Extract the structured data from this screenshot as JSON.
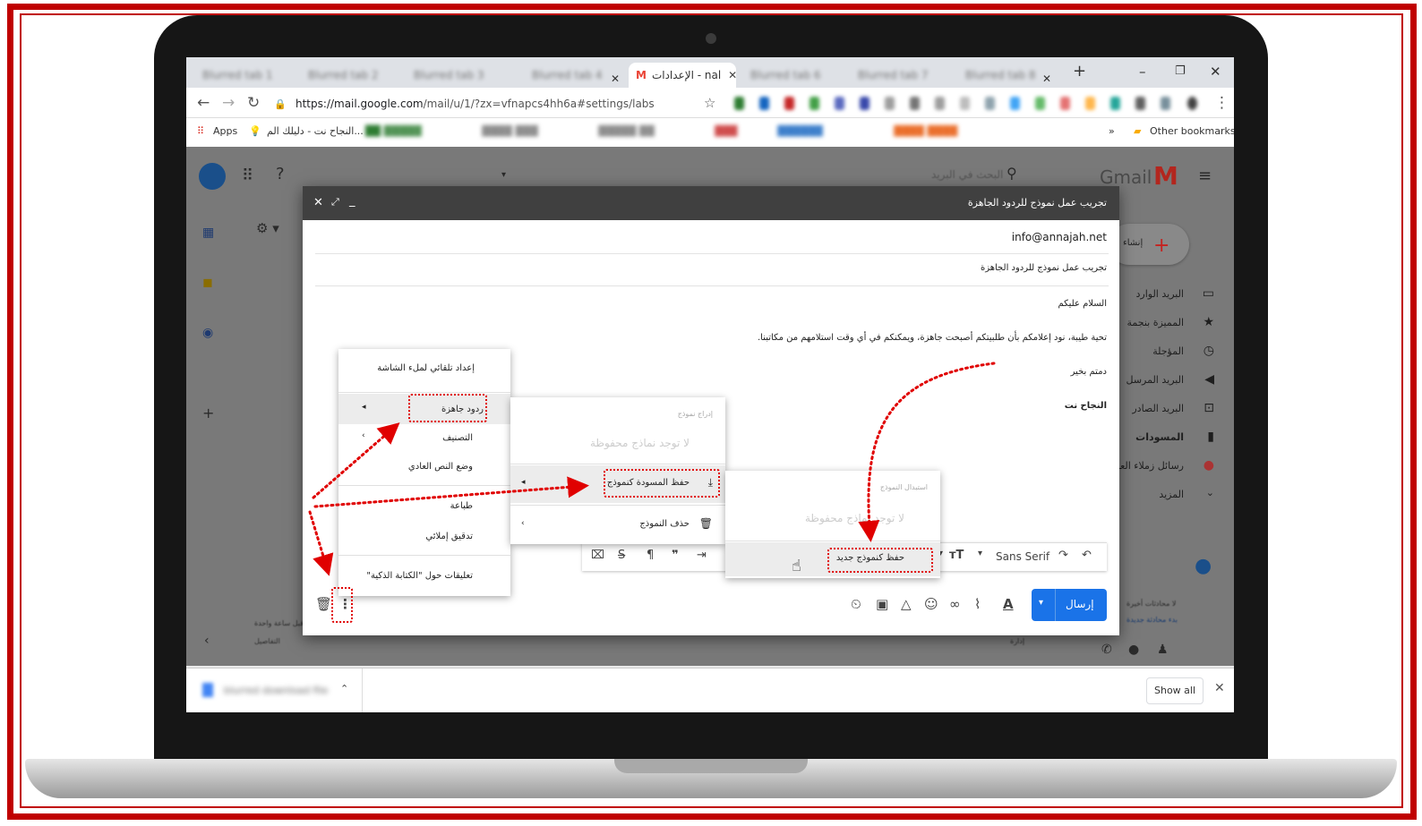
{
  "browser": {
    "tabs": [
      {
        "label": "Blurred tab 1",
        "blurred": true
      },
      {
        "label": "Blurred tab 2",
        "blurred": true
      },
      {
        "label": "Blurred tab 3",
        "blurred": true
      },
      {
        "label": "Blurred tab 4",
        "blurred": true
      },
      {
        "label": "الإعدادات - nal",
        "active": true
      },
      {
        "label": "Blurred tab 6",
        "blurred": true
      },
      {
        "label": "Blurred tab 7",
        "blurred": true
      },
      {
        "label": "Blurred tab 8",
        "blurred": true
      }
    ],
    "url_host": "https://mail.google.com",
    "url_path": "/mail/u/1/?zx=vfnapcs4hh6a#settings/labs",
    "bookmarks": {
      "apps": "Apps",
      "first": "النجاح نت - دليلك الم...",
      "more": "»",
      "other": "Other bookmarks"
    },
    "new_tab": "+"
  },
  "gmail": {
    "logo": "Gmail",
    "search_placeholder": "البحث في البريد",
    "compose": "إنشاء",
    "nav": [
      {
        "label": "البريد الوارد",
        "icon": "inbox-icon"
      },
      {
        "label": "المميزة بنجمة",
        "icon": "star-icon"
      },
      {
        "label": "المؤجلة",
        "icon": "clock-icon"
      },
      {
        "label": "البريد المرسل",
        "icon": "send-icon"
      },
      {
        "label": "البريد الصادر",
        "icon": "outbox-icon"
      },
      {
        "label": "المسودات",
        "icon": "draft-icon"
      },
      {
        "label": "رسائل زملاء العمل",
        "icon": "label-icon"
      },
      {
        "label": "المزيد",
        "icon": "chevron-down-icon"
      }
    ],
    "left_fragments": {
      "a": "آخر نشاط للحساب: قبل ساعة واحدة",
      "b": "التفاصيل",
      "c": "إدارة"
    },
    "right_fragments": {
      "a": "لا محادثات أخيرة",
      "b": "بدء محادثة جديدة"
    }
  },
  "compose": {
    "title": "تجريب عمل نموذج للردود الجاهزة",
    "to": "info@annajah.net",
    "subject": "تجريب عمل نموذج للردود الجاهزة",
    "body": [
      "السلام عليكم",
      "تحية طيبة، نود إعلامكم بأن طلبيتكم أصبحت جاهزة، ويمكنكم في أي وقت استلامهم من مكاتبنا.",
      "دمتم بخير",
      "النجاح نت"
    ],
    "font": "Sans Serif",
    "send": "إرسال"
  },
  "menu_more": [
    "إعداد تلقائي لملء الشاشة",
    "ردود جاهزة",
    "التصنيف",
    "وضع النص العادي",
    "طباعة",
    "تدقيق إملائي",
    "تعليقات حول \"الكتابة الذكية\""
  ],
  "menu_canned": {
    "insert_header": "إدراج نموذج",
    "no_templates": "لا توجد نماذج محفوظة",
    "save_draft": "حفظ المسودة كنموذج",
    "delete": "حذف النموذج"
  },
  "menu_save": {
    "overwrite_header": "استبدال النموذج",
    "no_templates": "لا توجد نماذج محفوظة",
    "save_new": "حفظ كنموذج جديد"
  },
  "downloads": {
    "file": "blurred download file",
    "show_all": "Show all"
  },
  "colors": {
    "frame": "#c00000",
    "annotation": "#e00000",
    "send_button": "#1a73e8",
    "gmail_red": "#ea4335"
  }
}
